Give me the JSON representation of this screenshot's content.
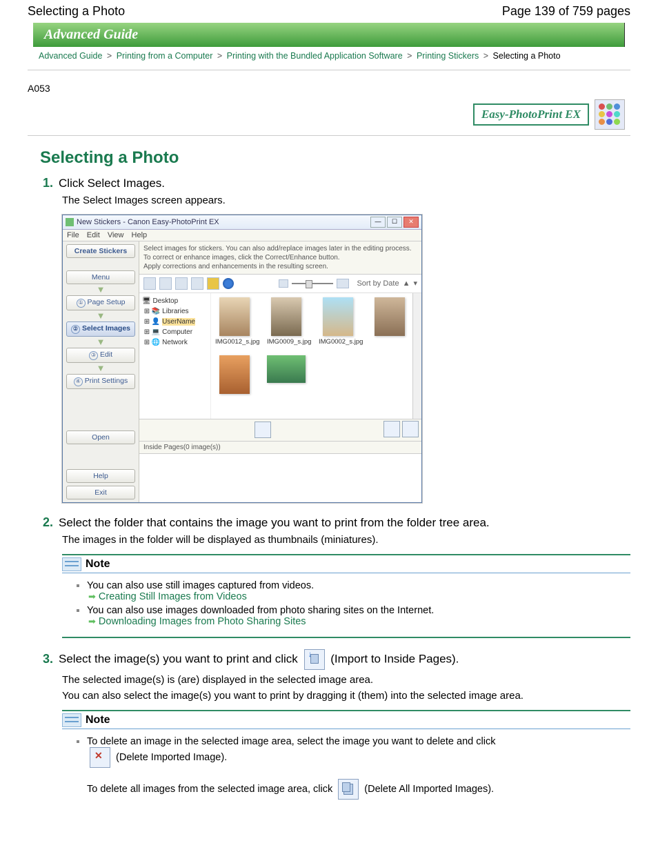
{
  "header": {
    "title": "Selecting a Photo",
    "pager": "Page 139 of 759 pages"
  },
  "banner": "Advanced Guide",
  "breadcrumb": {
    "l1": "Advanced Guide",
    "l2": "Printing from a Computer",
    "l3": "Printing with the Bundled Application Software",
    "l4": "Printing Stickers",
    "current": "Selecting a Photo",
    "sep": ">"
  },
  "topic_id": "A053",
  "brand_label": "Easy-PhotoPrint EX",
  "topic_title": "Selecting a Photo",
  "steps": {
    "s1": {
      "num": "1.",
      "title": "Click Select Images.",
      "desc": "The Select Images screen appears."
    },
    "s2": {
      "num": "2.",
      "title": "Select the folder that contains the image you want to print from the folder tree area.",
      "desc": "The images in the folder will be displayed as thumbnails (miniatures)."
    },
    "s3": {
      "num": "3.",
      "pre": "Select the image(s) you want to print and click",
      "post": "(Import to Inside Pages).",
      "desc1": "The selected image(s) is (are) displayed in the selected image area.",
      "desc2": "You can also select the image(s) you want to print by dragging it (them) into the selected image area."
    }
  },
  "note1": {
    "title": "Note",
    "li1": "You can also use still images captured from videos.",
    "link1": "Creating Still Images from Videos",
    "li2": "You can also use images downloaded from photo sharing sites on the Internet.",
    "link2": "Downloading Images from Photo Sharing Sites"
  },
  "note2": {
    "title": "Note",
    "li1": "To delete an image in the selected image area, select the image you want to delete and click",
    "li1_post": "(Delete Imported Image).",
    "li2_pre": "To delete all images from the selected image area, click",
    "li2_post": "(Delete All Imported Images)."
  },
  "app": {
    "title": "New Stickers - Canon Easy-PhotoPrint EX",
    "menu": {
      "file": "File",
      "edit": "Edit",
      "view": "View",
      "help": "Help"
    },
    "info1": "Select images for stickers. You can also add/replace images later in the editing process.",
    "info2": "To correct or enhance images, click the Correct/Enhance button.",
    "info3": "Apply corrections and enhancements in the resulting screen.",
    "sidebar": {
      "create": "Create Stickers",
      "menu": "Menu",
      "page_setup": "Page Setup",
      "select_images": "Select Images",
      "edit": "Edit",
      "print_settings": "Print Settings",
      "open": "Open",
      "help": "Help",
      "exit": "Exit"
    },
    "sort": "Sort by Date",
    "tree": {
      "desktop": "Desktop",
      "libraries": "Libraries",
      "username": "UserName",
      "computer": "Computer",
      "network": "Network"
    },
    "thumbs": {
      "t1": "IMG0012_s.jpg",
      "t2": "IMG0009_s.jpg",
      "t3": "IMG0002_s.jpg"
    },
    "selarea_label": "Inside Pages(0 image(s))"
  }
}
